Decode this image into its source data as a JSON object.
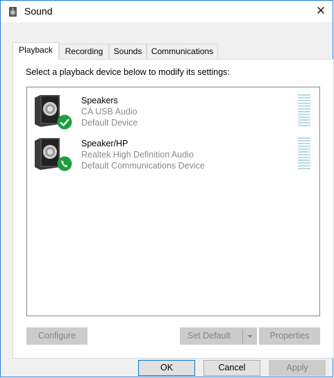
{
  "window": {
    "title": "Sound",
    "close_glyph": "✕",
    "icon": "speaker-icon"
  },
  "tabs": [
    {
      "label": "Playback",
      "active": true
    },
    {
      "label": "Recording",
      "active": false
    },
    {
      "label": "Sounds",
      "active": false
    },
    {
      "label": "Communications",
      "active": false
    }
  ],
  "panel": {
    "instruction": "Select a playback device below to modify its settings:"
  },
  "devices": [
    {
      "name": "Speakers",
      "driver": "CA USB Audio",
      "status": "Default Device",
      "badge": "check-badge-icon",
      "badge_color": "#1f9e3b"
    },
    {
      "name": "Speaker/HP",
      "driver": "Realtek High Definition Audio",
      "status": "Default Communications Device",
      "badge": "phone-badge-icon",
      "badge_color": "#1f9e3b"
    }
  ],
  "buttons": {
    "configure": "Configure",
    "set_default": "Set Default",
    "properties": "Properties",
    "ok": "OK",
    "cancel": "Cancel",
    "apply": "Apply"
  },
  "colors": {
    "accent": "#0078d7",
    "meter": "#b6dbe5",
    "disabled_text": "#838383"
  }
}
